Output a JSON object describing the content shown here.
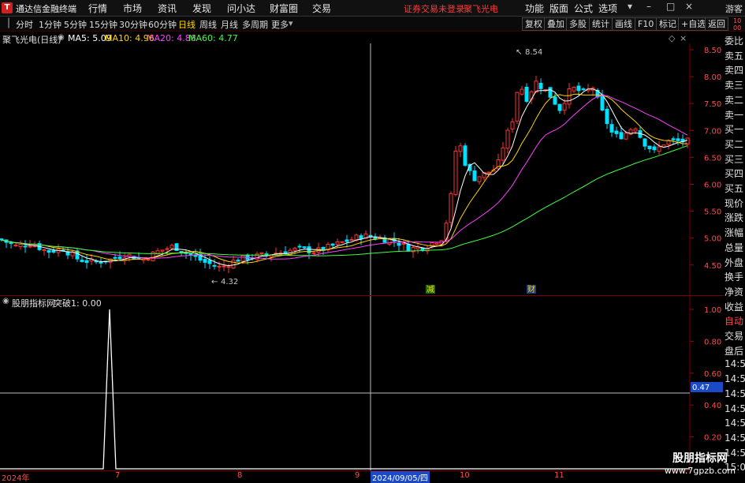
{
  "menubar": {
    "app_title": "通达信金融终端",
    "menus": [
      "行情",
      "市场",
      "资讯",
      "发现",
      "问小达",
      "财富圈",
      "交易"
    ],
    "warning": "证券交易未登录",
    "stock_name": "聚飞光电",
    "right_menus": [
      "功能",
      "版面",
      "公式",
      "选项"
    ],
    "guest": "游客"
  },
  "periodbar": {
    "periods": [
      "分时",
      "1分钟",
      "5分钟",
      "15分钟",
      "30分钟",
      "60分钟",
      "日线",
      "周线",
      "月线",
      "多周期",
      "更多"
    ],
    "active": "日线",
    "tools": [
      "复权",
      "叠加",
      "多股",
      "统计",
      "画线",
      "F10",
      "标记",
      "+自选",
      "返回"
    ]
  },
  "main_chart": {
    "title": "聚飞光电(日线)",
    "ma": [
      {
        "label": "MA5: 5.09",
        "color": "#ffffff"
      },
      {
        "label": "MA10: 4.96",
        "color": "#ffd400"
      },
      {
        "label": "MA20: 4.88",
        "color": "#ff40ff"
      },
      {
        "label": "MA60: 4.77",
        "color": "#40ff40"
      }
    ],
    "high_label": "8.54",
    "low_label": "4.32",
    "markers": [
      {
        "text": "减"
      },
      {
        "text": "财"
      }
    ],
    "y_ticks": [
      "8.50",
      "8.00",
      "7.50",
      "7.00",
      "6.50",
      "6.00",
      "5.50",
      "5.00",
      "4.50"
    ]
  },
  "sub_chart": {
    "title": "股朋指标网",
    "series_label": "突破1: 0.00",
    "y_ticks": [
      "1.00",
      "0.80",
      "0.60",
      "0.40",
      "0.20"
    ],
    "cursor_value": "0.47"
  },
  "chart_data": {
    "type": "line",
    "title": "股朋指标网",
    "series": [
      {
        "name": "突破1",
        "x": [
          "2024-06-24",
          "2024-06-25",
          "2024-06-26"
        ],
        "values": [
          0,
          1,
          0
        ]
      }
    ],
    "ylim": [
      0,
      1.1
    ]
  },
  "sidepanel": {
    "items": [
      "委比",
      "卖五",
      "卖四",
      "卖三",
      "卖二",
      "卖一",
      "买一",
      "买二",
      "买三",
      "买四",
      "买五",
      "现价",
      "涨跌",
      "涨幅",
      "总量",
      "外盘",
      "换手",
      "净资",
      "收益",
      "自动",
      "交易",
      "盘后",
      "14:56",
      "14:56",
      "14:56",
      "14:56",
      "14:56",
      "14:56",
      "14:56",
      "15:00"
    ],
    "top_digits": "1000"
  },
  "datebar": {
    "labels": [
      "2024年",
      "7",
      "8",
      "9",
      "10",
      "11"
    ],
    "cursor_date": "2024/09/05/四"
  },
  "watermark": {
    "line1": "股朋指标网",
    "line2": "www.7gpzb.com"
  },
  "colors": {
    "up": "#ff3232",
    "down": "#00e0ff",
    "ma5": "#ffffff",
    "ma10": "#ffd400",
    "ma20": "#ff40ff",
    "ma60": "#40ff40"
  }
}
